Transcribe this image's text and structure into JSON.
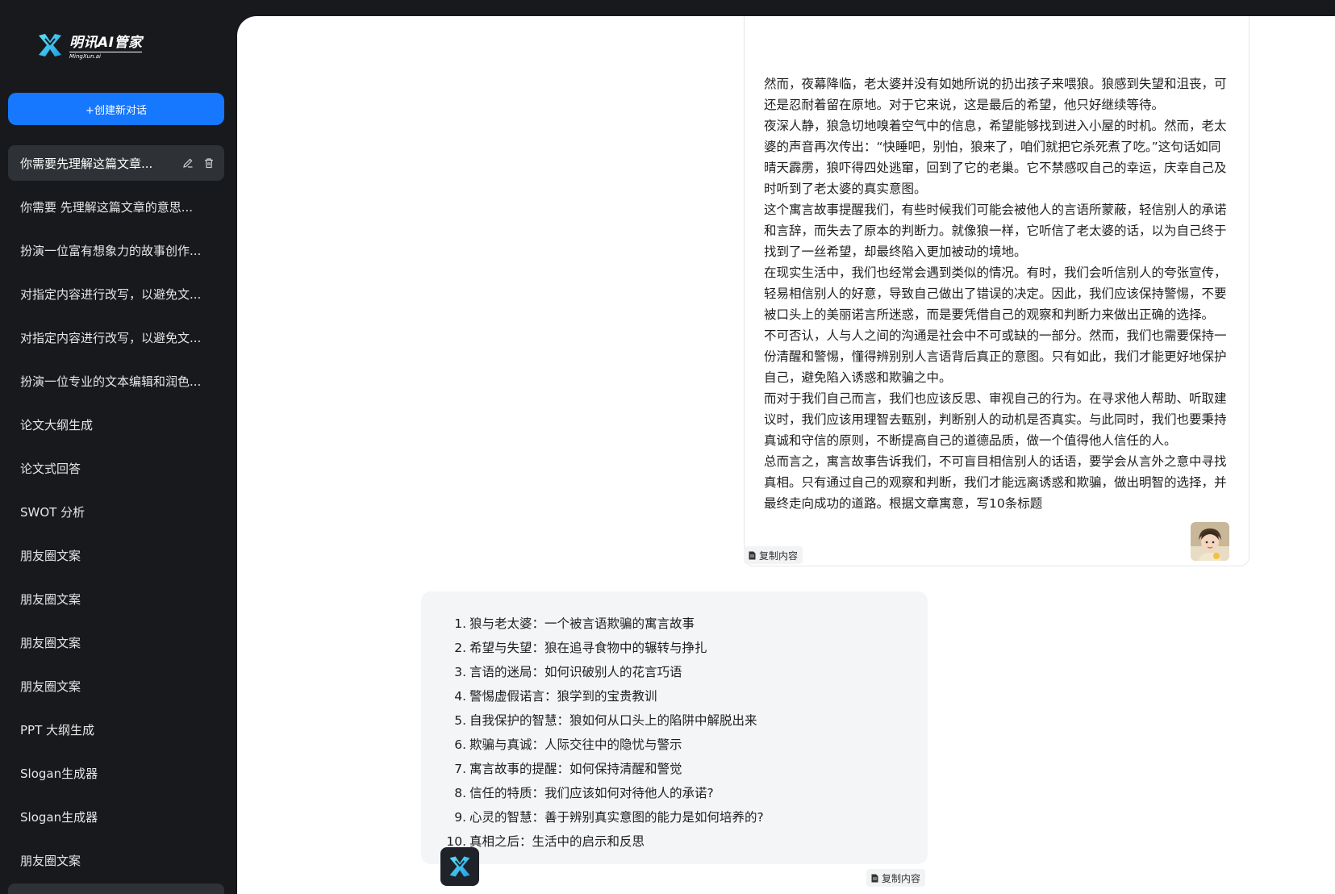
{
  "brand": {
    "name": "明讯AI管家",
    "sub": "MingXun.ai",
    "accent": "#1677ff"
  },
  "sidebar": {
    "new_chat_label": "+创建新对话",
    "items": [
      {
        "label": "你需要先理解这篇文章..."
      },
      {
        "label": "你需要 先理解这篇文章的意思..."
      },
      {
        "label": "扮演一位富有想象力的故事创作..."
      },
      {
        "label": "对指定内容进行改写，以避免文..."
      },
      {
        "label": "对指定内容进行改写，以避免文..."
      },
      {
        "label": "扮演一位专业的文本编辑和润色..."
      },
      {
        "label": "论文大纲生成"
      },
      {
        "label": "论文式回答"
      },
      {
        "label": "SWOT 分析"
      },
      {
        "label": "朋友圈文案"
      },
      {
        "label": "朋友圈文案"
      },
      {
        "label": "朋友圈文案"
      },
      {
        "label": "朋友圈文案"
      },
      {
        "label": "PPT 大纲生成"
      },
      {
        "label": "Slogan生成器"
      },
      {
        "label": "Slogan生成器"
      },
      {
        "label": "朋友圈文案"
      }
    ]
  },
  "chat": {
    "user_message": {
      "paragraphs": [
        "然而，夜幕降临，老太婆并没有如她所说的扔出孩子来喂狼。狼感到失望和沮丧，可还是忍耐着留在原地。对于它来说，这是最后的希望，他只好继续等待。",
        "夜深人静，狼急切地嗅着空气中的信息，希望能够找到进入小屋的时机。然而，老太婆的声音再次传出：“快睡吧，别怕，狼来了，咱们就把它杀死煮了吃。”这句话如同晴天霹雳，狼吓得四处逃窜，回到了它的老巢。它不禁感叹自己的幸运，庆幸自己及时听到了老太婆的真实意图。",
        "这个寓言故事提醒我们，有些时候我们可能会被他人的言语所蒙蔽，轻信别人的承诺和言辞，而失去了原本的判断力。就像狼一样，它听信了老太婆的话，以为自己终于找到了一丝希望，却最终陷入更加被动的境地。",
        "在现实生活中，我们也经常会遇到类似的情况。有时，我们会听信别人的夸张宣传，轻易相信别人的好意，导致自己做出了错误的决定。因此，我们应该保持警惕，不要被口头上的美丽诺言所迷惑，而是要凭借自己的观察和判断力来做出正确的选择。",
        "不可否认，人与人之间的沟通是社会中不可或缺的一部分。然而，我们也需要保持一份清醒和警惕，懂得辨别别人言语背后真正的意图。只有如此，我们才能更好地保护自己，避免陷入诱惑和欺骗之中。",
        "而对于我们自己而言，我们也应该反思、审视自己的行为。在寻求他人帮助、听取建议时，我们应该用理智去甄别，判断别人的动机是否真实。与此同时，我们也要秉持真诚和守信的原则，不断提高自己的道德品质，做一个值得他人信任的人。",
        "总而言之，寓言故事告诉我们，不可盲目相信别人的话语，要学会从言外之意中寻找真相。只有通过自己的观察和判断，我们才能远离诱惑和欺骗，做出明智的选择，并最终走向成功的道路。根据文章寓意，写10条标题"
      ],
      "copy_label": "复制内容"
    },
    "ai_message": {
      "items": [
        {
          "num": "1.",
          "text": "狼与老太婆：一个被言语欺骗的寓言故事"
        },
        {
          "num": "2.",
          "text": "希望与失望：狼在追寻食物中的辗转与挣扎"
        },
        {
          "num": "3.",
          "text": "言语的迷局：如何识破别人的花言巧语"
        },
        {
          "num": "4.",
          "text": "警惕虚假诺言：狼学到的宝贵教训"
        },
        {
          "num": "5.",
          "text": "自我保护的智慧：狼如何从口头上的陷阱中解脱出来"
        },
        {
          "num": "6.",
          "text": "欺骗与真诚：人际交往中的隐忧与警示"
        },
        {
          "num": "7.",
          "text": "寓言故事的提醒：如何保持清醒和警觉"
        },
        {
          "num": "8.",
          "text": "信任的特质：我们应该如何对待他人的承诺?"
        },
        {
          "num": "9.",
          "text": "心灵的智慧：善于辨别真实意图的能力是如何培养的?"
        },
        {
          "num": "10.",
          "text": "真相之后：生活中的启示和反思"
        }
      ],
      "copy_label": "复制内容"
    }
  }
}
